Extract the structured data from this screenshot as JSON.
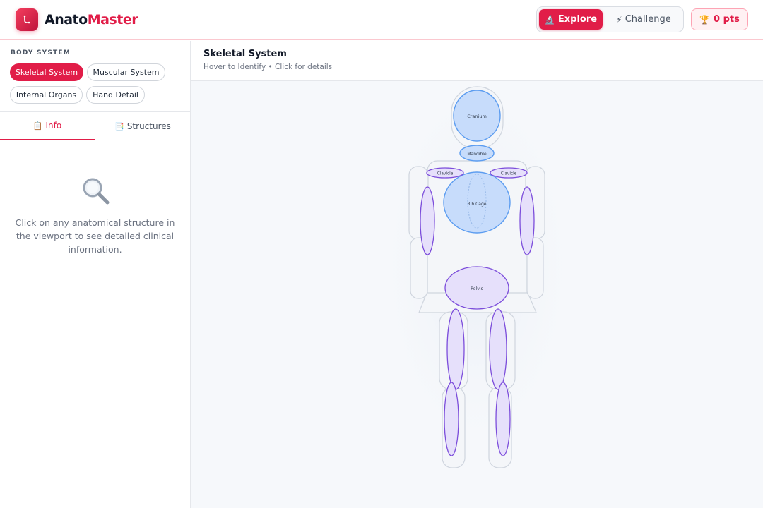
{
  "app": {
    "brand_part1": "Anato",
    "brand_part2": "Master",
    "accent_color": "#e11d48"
  },
  "header": {
    "modes": [
      {
        "label": "Explore",
        "icon": "microscope-icon",
        "glyph": "🔬",
        "active": true
      },
      {
        "label": "Challenge",
        "icon": "lightning-icon",
        "glyph": "⚡",
        "active": false
      }
    ],
    "points": {
      "label": "0 pts",
      "icon": "trophy-icon",
      "glyph": "🏆"
    }
  },
  "sidebar": {
    "section_label": "BODY SYSTEM",
    "systems": [
      {
        "label": "Skeletal System",
        "active": true
      },
      {
        "label": "Muscular System",
        "active": false
      },
      {
        "label": "Internal Organs",
        "active": false
      },
      {
        "label": "Hand Detail",
        "active": false
      }
    ],
    "tabs": [
      {
        "label": "Info",
        "icon": "clipboard-icon",
        "glyph": "📋",
        "active": true
      },
      {
        "label": "Structures",
        "icon": "bookmark-tabs-icon",
        "glyph": "📑",
        "active": false
      }
    ],
    "empty_state": {
      "icon": "magnifier-icon",
      "text": "Click on any anatomical structure in the viewport to see detailed clinical information."
    }
  },
  "main": {
    "title": "Skeletal System",
    "subtitle": "Hover to Identify • Click for details",
    "structures": {
      "cranium": "Cranium",
      "mandible": "Mandible",
      "clavicle_left": "Clavicle",
      "clavicle_right": "Clavicle",
      "rib_cage": "Rib Cage",
      "pelvis": "Pelvis"
    },
    "colors": {
      "bone_blue_fill": "#c7dcfb",
      "bone_blue_stroke": "#5b9cf0",
      "bone_purple_fill": "#e6e0fb",
      "bone_purple_stroke": "#7c4ddb",
      "body_outline": "#cfd5de"
    }
  }
}
